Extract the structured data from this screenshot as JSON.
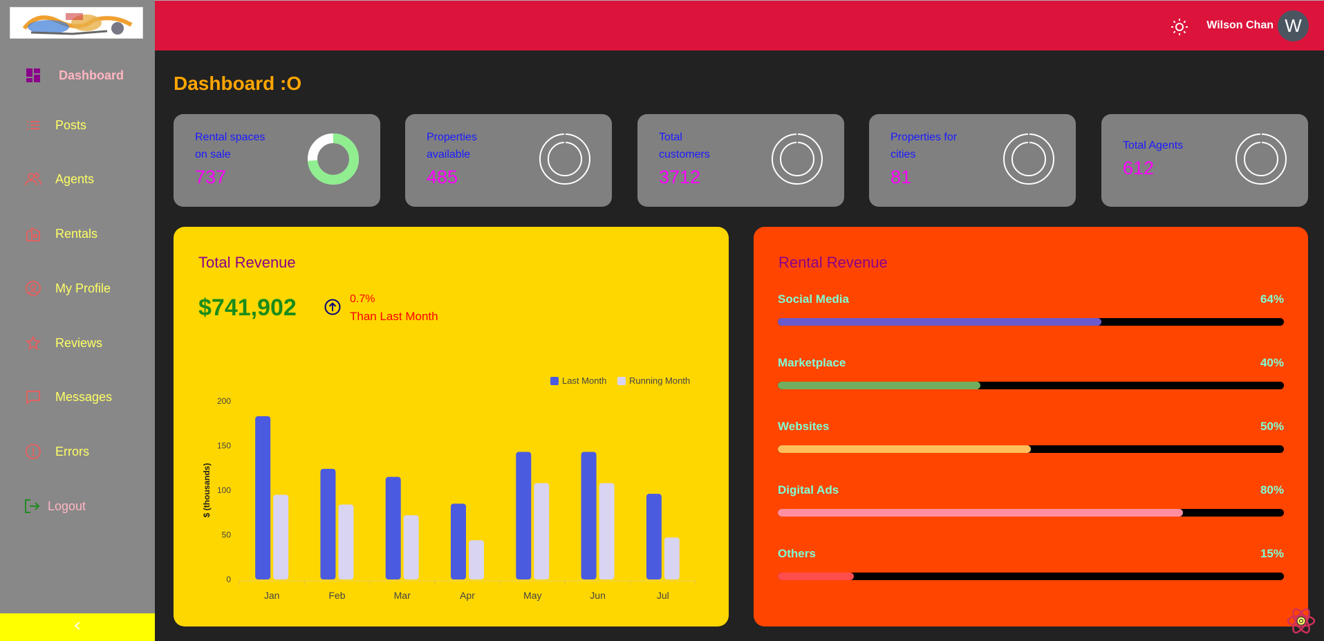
{
  "sidebar": {
    "items": [
      {
        "label": "Dashboard",
        "icon": "dashboard-icon",
        "active": true
      },
      {
        "label": "Posts",
        "icon": "list-icon"
      },
      {
        "label": "Agents",
        "icon": "people-icon"
      },
      {
        "label": "Rentals",
        "icon": "building-icon"
      },
      {
        "label": "My Profile",
        "icon": "user-circle-icon"
      },
      {
        "label": "Reviews",
        "icon": "star-icon"
      },
      {
        "label": "Messages",
        "icon": "message-icon"
      },
      {
        "label": "Errors",
        "icon": "error-icon"
      },
      {
        "label": "Logout",
        "icon": "logout-icon"
      }
    ],
    "collapse_icon": "chevron-left-icon"
  },
  "topbar": {
    "user_name": "Wilson Chan",
    "avatar_initial": "W",
    "theme_icon": "sun-icon"
  },
  "main": {
    "title": "Dashboard :O",
    "stats": [
      {
        "label_line1": "Rental spaces",
        "label_line2": "on sale",
        "value": "737",
        "ring_fraction": 0.737
      },
      {
        "label_line1": "Properties",
        "label_line2": "available",
        "value": "485",
        "ring_fraction": 0
      },
      {
        "label_line1": "Total",
        "label_line2": "customers",
        "value": "3712",
        "ring_fraction": 0
      },
      {
        "label_line1": "Properties for",
        "label_line2": "cities",
        "value": "81",
        "ring_fraction": 0
      },
      {
        "label_line1": "Total Agents",
        "label_line2": "",
        "value": "612",
        "ring_fraction": 0
      }
    ]
  },
  "revenue": {
    "title": "Total Revenue",
    "amount": "$741,902",
    "change_pct": "0.7%",
    "change_note": "Than Last Month",
    "change_icon": "arrow-up-circle-icon"
  },
  "chart_data": {
    "type": "bar",
    "categories": [
      "Jan",
      "Feb",
      "Mar",
      "Apr",
      "May",
      "Jun",
      "Jul"
    ],
    "series": [
      {
        "name": "Last Month",
        "values": [
          183,
          124,
          115,
          85,
          143,
          143,
          96
        ],
        "color": "#4b5be0"
      },
      {
        "name": "Running Month",
        "values": [
          95,
          84,
          72,
          44,
          108,
          108,
          47
        ],
        "color": "#d8d4f2"
      }
    ],
    "ylabel": "$ (thousands)",
    "xlabel": "",
    "ylim": [
      0,
      200
    ],
    "yticks": [
      0,
      50,
      100,
      150,
      200
    ],
    "legend": "top-right",
    "grid": false
  },
  "rental": {
    "title": "Rental Revenue",
    "sources": [
      {
        "name": "Social Media",
        "pct_label": "64%",
        "value": 64,
        "color": "#6a5acd"
      },
      {
        "name": "Marketplace",
        "pct_label": "40%",
        "value": 40,
        "color": "#6fae5e"
      },
      {
        "name": "Websites",
        "pct_label": "50%",
        "value": 50,
        "color": "#ffbf5a"
      },
      {
        "name": "Digital Ads",
        "pct_label": "80%",
        "value": 80,
        "color": "#ff8fa0"
      },
      {
        "name": "Others",
        "pct_label": "15%",
        "value": 15,
        "color": "#ff4d4d"
      }
    ]
  },
  "colors": {
    "sidebar_bg": "#888888",
    "topbar_bg": "#dc143c",
    "body_bg": "#222222",
    "title_accent": "#ffa500",
    "revenue_bg": "#ffd700",
    "rental_bg": "#ff4500"
  }
}
